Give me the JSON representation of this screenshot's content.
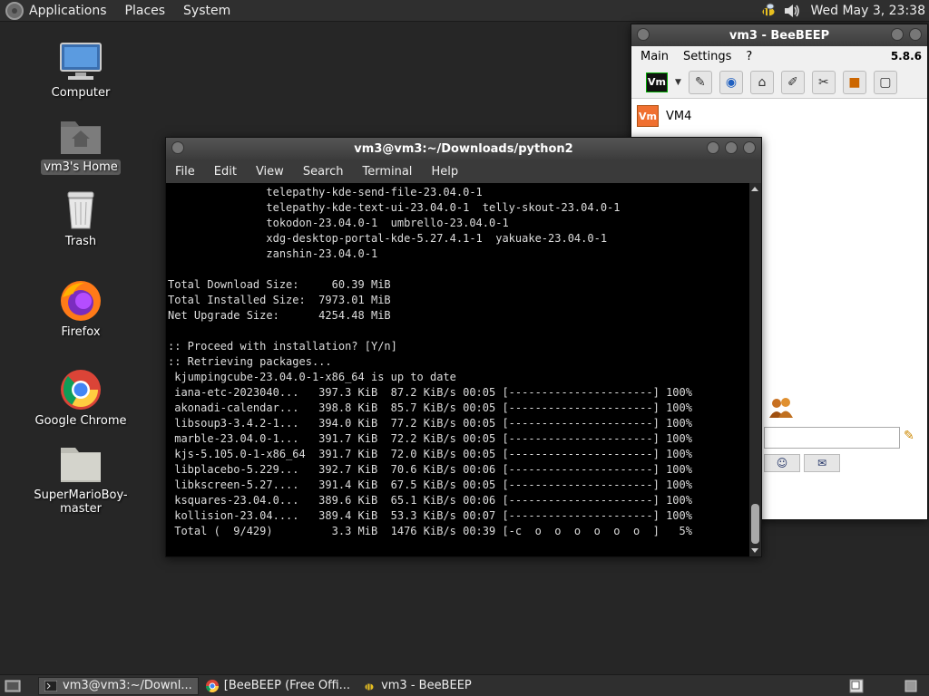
{
  "top_panel": {
    "menus": [
      "Applications",
      "Places",
      "System"
    ],
    "clock": "Wed May  3, 23:38",
    "tray_icons": [
      "beebeep-tray-icon",
      "volume-icon"
    ]
  },
  "desktop": {
    "icons": [
      {
        "label": "Computer",
        "icon": "computer-icon"
      },
      {
        "label": "vm3's Home",
        "icon": "home-folder-icon"
      },
      {
        "label": "Trash",
        "icon": "trash-icon"
      },
      {
        "label": "Firefox",
        "icon": "firefox-icon"
      },
      {
        "label": "Google Chrome",
        "icon": "chrome-icon"
      },
      {
        "label": "SuperMarioBoy-master",
        "icon": "folder-icon"
      }
    ]
  },
  "beebeep": {
    "title": "vm3 - BeeBEEP",
    "menus": [
      "Main",
      "Settings",
      "?"
    ],
    "version": "5.8.6",
    "user_badge": "Vm",
    "users": [
      {
        "avatar": "Vm",
        "name": "VM4"
      }
    ]
  },
  "terminal": {
    "title": "vm3@vm3:~/Downloads/python2",
    "menus": [
      "File",
      "Edit",
      "View",
      "Search",
      "Terminal",
      "Help"
    ],
    "lines": [
      "               telepathy-kde-send-file-23.04.0-1",
      "               telepathy-kde-text-ui-23.04.0-1  telly-skout-23.04.0-1",
      "               tokodon-23.04.0-1  umbrello-23.04.0-1",
      "               xdg-desktop-portal-kde-5.27.4.1-1  yakuake-23.04.0-1",
      "               zanshin-23.04.0-1",
      "",
      "Total Download Size:     60.39 MiB",
      "Total Installed Size:  7973.01 MiB",
      "Net Upgrade Size:      4254.48 MiB",
      "",
      ":: Proceed with installation? [Y/n]",
      ":: Retrieving packages...",
      " kjumpingcube-23.04.0-1-x86_64 is up to date",
      " iana-etc-2023040...   397.3 KiB  87.2 KiB/s 00:05 [----------------------] 100%",
      " akonadi-calendar...   398.8 KiB  85.7 KiB/s 00:05 [----------------------] 100%",
      " libsoup3-3.4.2-1...   394.0 KiB  77.2 KiB/s 00:05 [----------------------] 100%",
      " marble-23.04.0-1...   391.7 KiB  72.2 KiB/s 00:05 [----------------------] 100%",
      " kjs-5.105.0-1-x86_64  391.7 KiB  72.0 KiB/s 00:05 [----------------------] 100%",
      " libplacebo-5.229...   392.7 KiB  70.6 KiB/s 00:06 [----------------------] 100%",
      " libkscreen-5.27....   391.4 KiB  67.5 KiB/s 00:05 [----------------------] 100%",
      " ksquares-23.04.0...   389.6 KiB  65.1 KiB/s 00:06 [----------------------] 100%",
      " kollision-23.04....   389.4 KiB  53.3 KiB/s 00:07 [----------------------] 100%",
      " Total (  9/429)         3.3 MiB  1476 KiB/s 00:39 [-c  o  o  o  o  o  o  ]   5%"
    ]
  },
  "taskbar": {
    "tasks": [
      {
        "label": "vm3@vm3:~/Downl...",
        "icon": "terminal-icon",
        "active": true
      },
      {
        "label": "[BeeBEEP (Free Offi...",
        "icon": "chrome-icon",
        "active": false
      },
      {
        "label": "vm3 - BeeBEEP",
        "icon": "beebeep-icon",
        "active": false
      }
    ]
  },
  "colors": {
    "desktop_bg": "#262626",
    "panel_bg": "#2f2f2f",
    "terminal_bg": "#000000",
    "terminal_fg": "#dddddd",
    "beebeep_avatar": "#f07030"
  }
}
